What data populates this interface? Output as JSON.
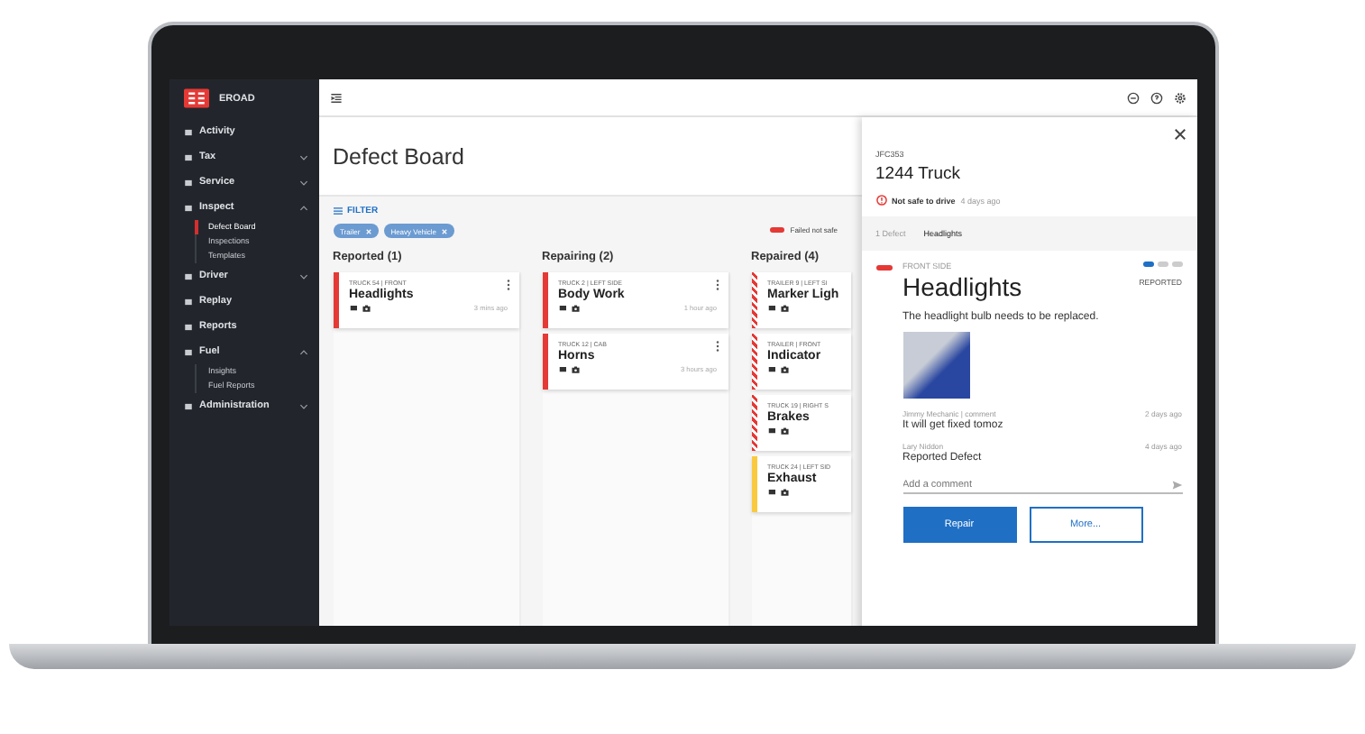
{
  "sidebar": {
    "brand": "EROAD",
    "items": [
      {
        "label": "Activity",
        "kind": "link",
        "selected": false
      },
      {
        "label": "Tax",
        "kind": "group",
        "expanded": false,
        "selected": false
      },
      {
        "label": "Service",
        "kind": "group",
        "expanded": false,
        "selected": false
      },
      {
        "label": "Inspect",
        "kind": "group",
        "expanded": true,
        "selected": false,
        "children": [
          {
            "label": "Defect Board",
            "selected": true
          },
          {
            "label": "Inspections",
            "selected": false
          },
          {
            "label": "Templates",
            "selected": false
          }
        ]
      },
      {
        "label": "Driver",
        "kind": "group",
        "expanded": false,
        "selected": false
      },
      {
        "label": "Replay",
        "kind": "link",
        "selected": false
      },
      {
        "label": "Reports",
        "kind": "link",
        "selected": false
      },
      {
        "label": "Fuel",
        "kind": "group",
        "expanded": true,
        "selected": false,
        "children": [
          {
            "label": "Insights",
            "selected": false
          },
          {
            "label": "Fuel Reports",
            "selected": false
          }
        ]
      },
      {
        "label": "Administration",
        "kind": "group",
        "expanded": false,
        "selected": false
      }
    ]
  },
  "page": {
    "title": "Defect Board"
  },
  "filter": {
    "label": "FILTER",
    "chips": [
      "Trailer",
      "Heavy Vehicle"
    ]
  },
  "legend": {
    "label": "Failed not safe",
    "color": "#e53935"
  },
  "columns": [
    {
      "title": "Reported (1)",
      "cards": [
        {
          "meta": "TRUCK 54 | FRONT",
          "title": "Headlights",
          "time": "3 mins ago",
          "kind": "solid",
          "color": "#e53935"
        }
      ]
    },
    {
      "title": "Repairing (2)",
      "cards": [
        {
          "meta": "TRUCK 2 | LEFT SIDE",
          "title": "Body Work",
          "time": "1 hour ago",
          "kind": "solid",
          "color": "#e53935"
        },
        {
          "meta": "TRUCK 12 | CAB",
          "title": "Horns",
          "time": "3 hours ago",
          "kind": "solid",
          "color": "#e53935"
        }
      ]
    },
    {
      "title": "Repaired (4)",
      "cards": [
        {
          "meta": "TRAILER 9 | LEFT SI",
          "title": "Marker Ligh",
          "kind": "hatched",
          "color": "#e53935"
        },
        {
          "meta": "TRAILER | FRONT",
          "title": "Indicator",
          "kind": "hatched",
          "color": "#e53935"
        },
        {
          "meta": "TRUCK 19 | RIGHT S",
          "title": "Brakes",
          "kind": "hatched",
          "color": "#e53935"
        },
        {
          "meta": "TRUCK 24 | LEFT SID",
          "title": "Exhaust",
          "kind": "solid",
          "color": "#fbc940"
        }
      ]
    }
  ],
  "panel": {
    "plate": "JFC353",
    "vehicle": "1244 Truck",
    "status": "Not safe to drive",
    "status_time": "4 days ago",
    "tabs": [
      {
        "label": "1 Defect",
        "selected": false
      },
      {
        "label": "Headlights",
        "selected": true
      }
    ],
    "defect": {
      "location": "FRONT SIDE",
      "color": "#e53935",
      "title": "Headlights",
      "stage": "REPORTED",
      "stages": [
        {
          "done": true
        },
        {
          "done": false
        },
        {
          "done": false
        }
      ],
      "description": "The headlight bulb needs to be replaced."
    },
    "comments": [
      {
        "author": "Jimmy Mechanic | comment",
        "time": "2 days ago",
        "text": "It will get fixed tomoz"
      },
      {
        "author": "Lary Niddon",
        "time": "4 days ago",
        "text": "Reported Defect"
      }
    ],
    "comment_field": {
      "placeholder": "Add a comment"
    },
    "buttons": [
      {
        "label": "Repair",
        "kind": "primary"
      },
      {
        "label": "More...",
        "kind": "outline"
      }
    ]
  }
}
